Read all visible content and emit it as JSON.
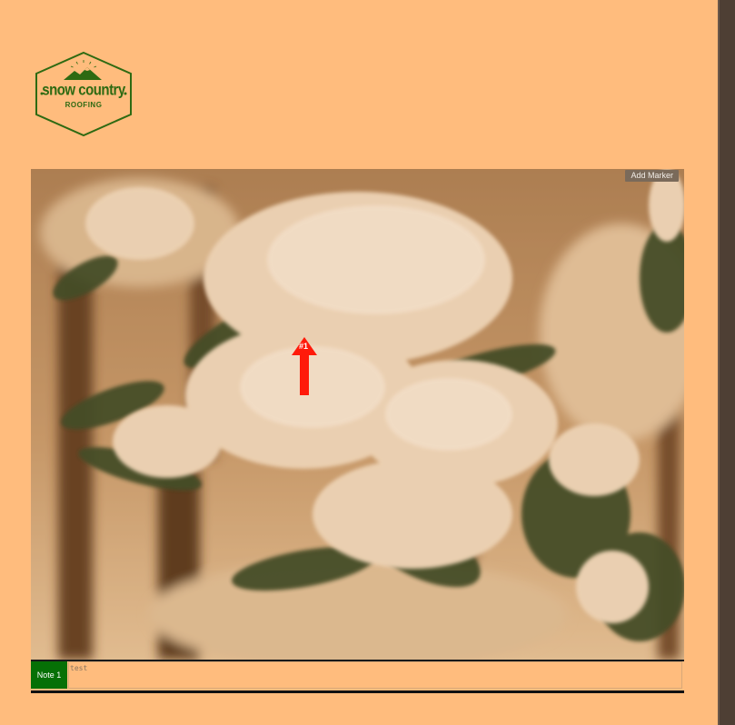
{
  "logo": {
    "main_text": "snow country",
    "sub_text": "ROOFING",
    "color": "#2e6a12"
  },
  "viewer": {
    "image_subject": "snow-covered hemlock branch",
    "add_marker_label": "Add Marker",
    "markers": [
      {
        "label": "#1",
        "color": "#ff1a0a",
        "icon": "arrow-up-icon"
      }
    ]
  },
  "notes": [
    {
      "tab_label": "Note 1",
      "text": "test"
    }
  ],
  "colors": {
    "page_background": "#ffbc7d",
    "note_tab": "#067006",
    "marker": "#ff1a0a",
    "scrollbar": "#4e3f34"
  }
}
